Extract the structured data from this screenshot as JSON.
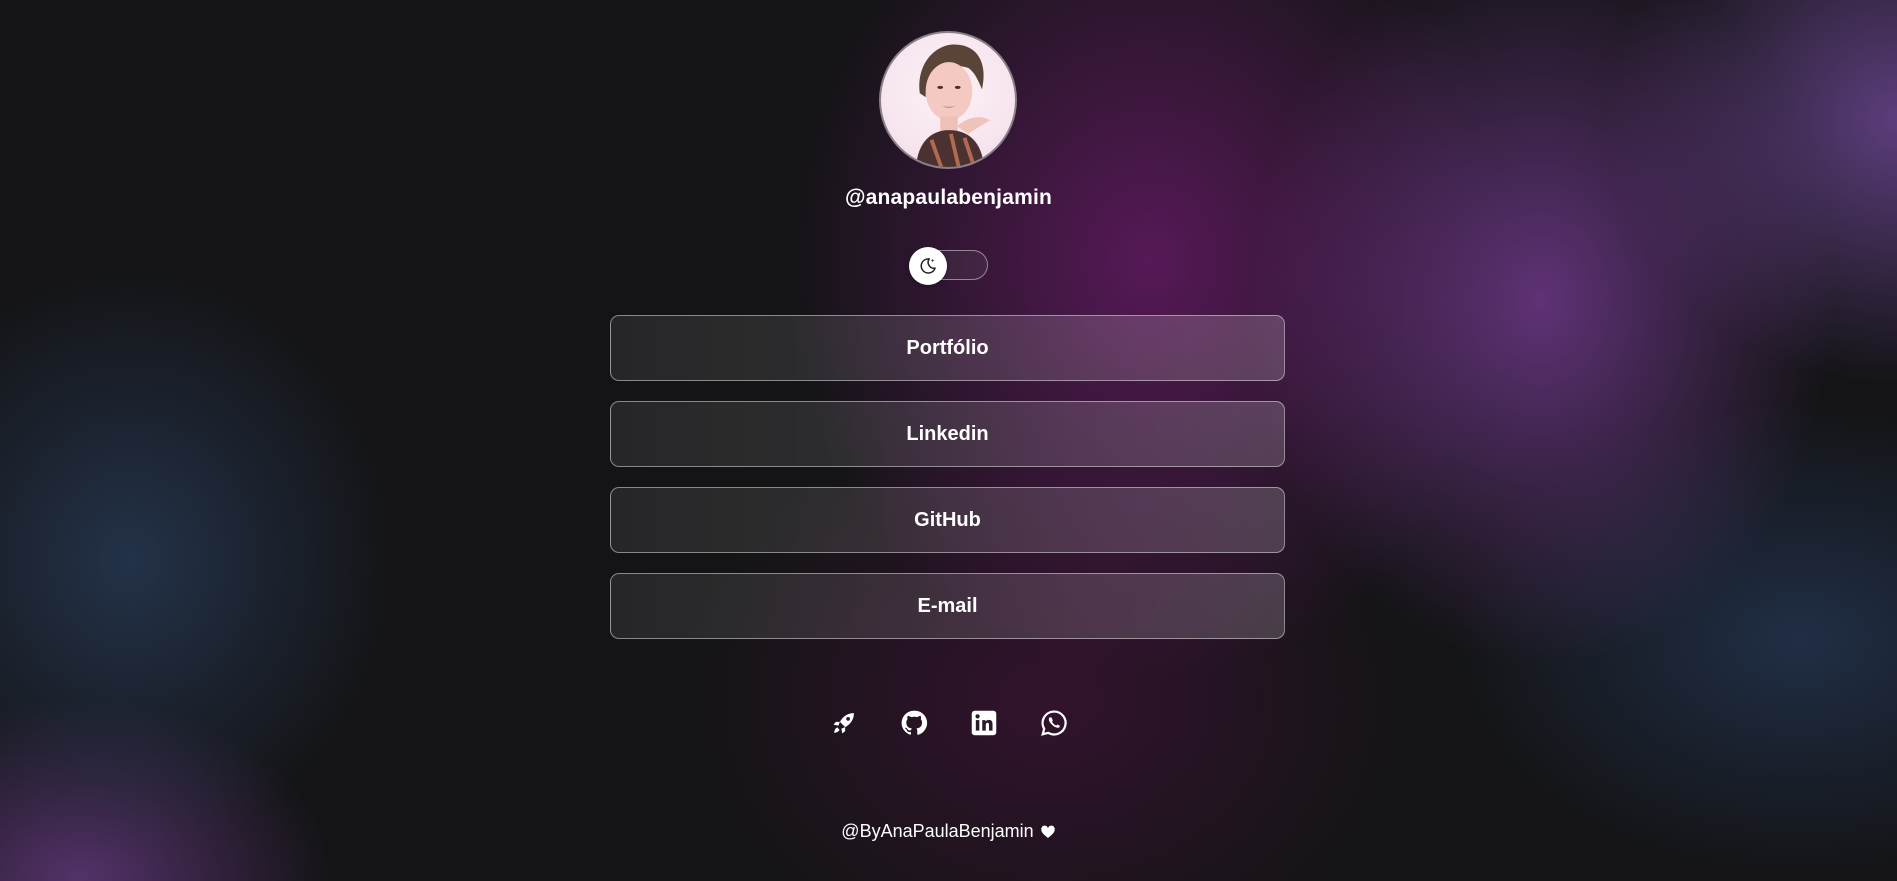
{
  "profile": {
    "username": "@anapaulabenjamin"
  },
  "theme_toggle": {
    "icon": "moon-stars-icon",
    "state": "dark"
  },
  "links": [
    {
      "label": "Portfólio"
    },
    {
      "label": "Linkedin"
    },
    {
      "label": "GitHub"
    },
    {
      "label": "E-mail"
    }
  ],
  "socials": [
    {
      "icon": "rocket-icon"
    },
    {
      "icon": "github-icon"
    },
    {
      "icon": "linkedin-icon"
    },
    {
      "icon": "whatsapp-icon"
    }
  ],
  "footer": {
    "text": "@ByAnaPaulaBenjamin",
    "icon": "heart-icon"
  },
  "colors": {
    "background": "#141416",
    "accent_purple": "#621a62",
    "text": "#ffffff"
  }
}
